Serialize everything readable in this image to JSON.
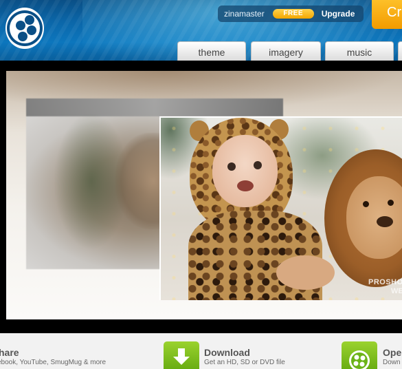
{
  "user": {
    "name": "zinamaster",
    "plan_badge": "FREE",
    "upgrade_label": "Upgrade"
  },
  "header": {
    "create_label": "Cr"
  },
  "tabs": [
    {
      "label": "theme"
    },
    {
      "label": "imagery"
    },
    {
      "label": "music"
    }
  ],
  "preview": {
    "watermark_line1": "PROSHO",
    "watermark_line2": "WE"
  },
  "actions": [
    {
      "title": "hare",
      "subtitle": "ebook, YouTube, SmugMug & more"
    },
    {
      "title": "Download",
      "subtitle": "Get an HD, SD or DVD file"
    },
    {
      "title": "Ope",
      "subtitle": "Down"
    }
  ],
  "colors": {
    "header_blue": "#0b66a8",
    "accent_orange": "#f3a600",
    "action_green": "#7cbf1e"
  },
  "icons": {
    "logo": "film-reel-logo-icon",
    "download": "download-arrow-icon",
    "open": "film-reel-icon"
  }
}
